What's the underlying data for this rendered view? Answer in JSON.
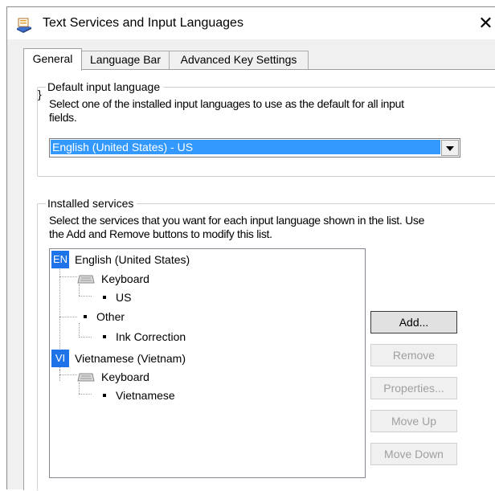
{
  "window": {
    "title": "Text Services and Input Languages",
    "close_glyph": "✕"
  },
  "tabs": [
    {
      "label": "General",
      "active": true
    },
    {
      "label": "Language Bar",
      "active": false
    },
    {
      "label": "Advanced Key Settings",
      "active": false
    }
  ],
  "default_language": {
    "group_title": "Default input language",
    "description_line1": "Select one of the installed input languages to use as the default for all input",
    "description_line2": "fields.",
    "selected_value": "English (United States) - US"
  },
  "installed_services": {
    "group_title": "Installed services",
    "description_line1": "Select the services that you want for each input language shown in the list. Use",
    "description_line2": "the Add and Remove buttons to modify this list.",
    "tree": {
      "lang1": {
        "badge": "EN",
        "name": "English (United States)"
      },
      "lang1_keyboard": "Keyboard",
      "lang1_keyboard_item": "US",
      "lang1_other": "Other",
      "lang1_other_item": "Ink Correction",
      "lang2": {
        "badge": "VI",
        "name": "Vietnamese (Vietnam)"
      },
      "lang2_keyboard": "Keyboard",
      "lang2_keyboard_item": "Vietnamese"
    },
    "buttons": {
      "add": "Add...",
      "remove": "Remove",
      "properties": "Properties...",
      "move_up": "Move Up",
      "move_down": "Move Down"
    }
  },
  "colors": {
    "selection": "#3399ff",
    "language_badge": "#1e73e8",
    "disabled_text": "#a0a0a0"
  },
  "icons": {
    "app": "text-services-icon",
    "keyboard": "keyboard-icon",
    "close": "close-icon"
  }
}
